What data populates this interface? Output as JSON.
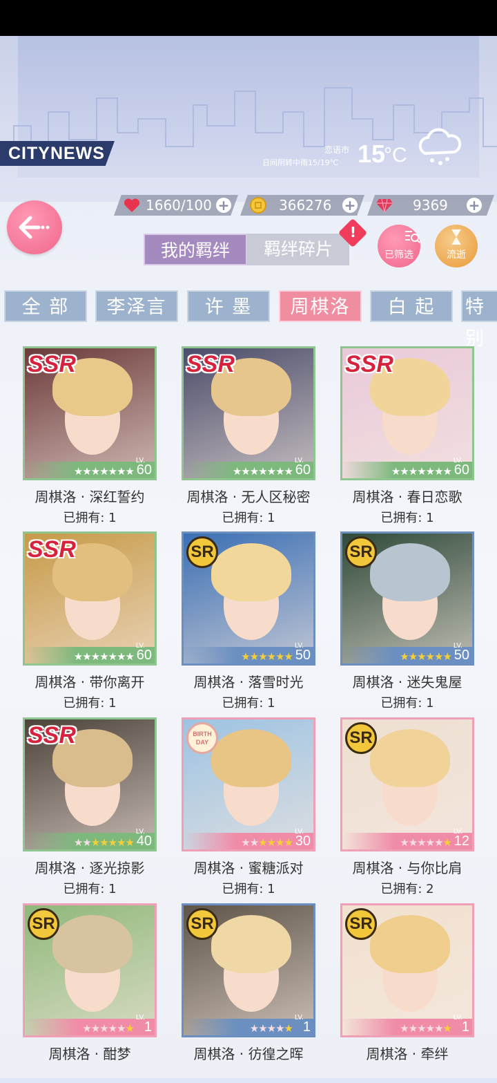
{
  "header": {
    "city_news_label": "CITYNEWS",
    "weather": {
      "city": "恋语市",
      "desc": "日间阴转中雨15/19℃",
      "temp": "15",
      "unit": "°C"
    }
  },
  "currencies": {
    "stamina": {
      "value": "1660/100",
      "icon": "heart-icon"
    },
    "coins": {
      "value": "366276",
      "icon": "coin-icon"
    },
    "diamonds": {
      "value": "9369",
      "icon": "diamond-icon"
    }
  },
  "tabs": {
    "bond": "我的羁绊",
    "fragments": "羁绊碎片"
  },
  "buttons": {
    "filter": "已筛选",
    "flow": "流逝"
  },
  "filters": [
    "全 部",
    "李泽言",
    "许 墨",
    "周棋洛",
    "白 起",
    "特别"
  ],
  "active_filter": "周棋洛",
  "cards": [
    {
      "name": "周棋洛 · 深红誓约",
      "owned": "已拥有: 1",
      "rarity": "SSR",
      "level": "60",
      "stars": 7,
      "lit": 7
    },
    {
      "name": "周棋洛 · 无人区秘密",
      "owned": "已拥有: 1",
      "rarity": "SSR",
      "level": "60",
      "stars": 7,
      "lit": 7
    },
    {
      "name": "周棋洛 · 春日恋歌",
      "owned": "已拥有: 1",
      "rarity": "SSR",
      "level": "60",
      "stars": 7,
      "lit": 7
    },
    {
      "name": "周棋洛 · 带你离开",
      "owned": "已拥有: 1",
      "rarity": "SSR",
      "level": "60",
      "stars": 7,
      "lit": 7
    },
    {
      "name": "周棋洛 · 落雪时光",
      "owned": "已拥有: 1",
      "rarity": "SR",
      "level": "50",
      "stars": 6,
      "lit": 6
    },
    {
      "name": "周棋洛 · 迷失鬼屋",
      "owned": "已拥有: 1",
      "rarity": "SR",
      "level": "50",
      "stars": 6,
      "lit": 6
    },
    {
      "name": "周棋洛 · 逐光掠影",
      "owned": "已拥有: 1",
      "rarity": "SSR",
      "level": "40",
      "stars": 7,
      "lit": 5
    },
    {
      "name": "周棋洛 · 蜜糖派对",
      "owned": "已拥有: 1",
      "rarity": "BIRTHDAY",
      "level": "30",
      "stars": 6,
      "lit": 4
    },
    {
      "name": "周棋洛 · 与你比肩",
      "owned": "已拥有: 2",
      "rarity": "SR",
      "level": "12",
      "stars": 6,
      "lit": 1
    },
    {
      "name": "周棋洛 · 酣梦",
      "owned": "",
      "rarity": "SR",
      "level": "1",
      "stars": 6,
      "lit": 1
    },
    {
      "name": "周棋洛 · 彷徨之晖",
      "owned": "",
      "rarity": "SR",
      "level": "1",
      "stars": 5,
      "lit": 1
    },
    {
      "name": "周棋洛 · 牵绊",
      "owned": "",
      "rarity": "SR",
      "level": "1",
      "stars": 6,
      "lit": 1
    }
  ],
  "colors": {
    "ssr_frame": "#8fc58f",
    "sr_frame": "#6b8fc0",
    "pink_frame": "#f0a0b6",
    "active_tab": "#f08da1"
  }
}
